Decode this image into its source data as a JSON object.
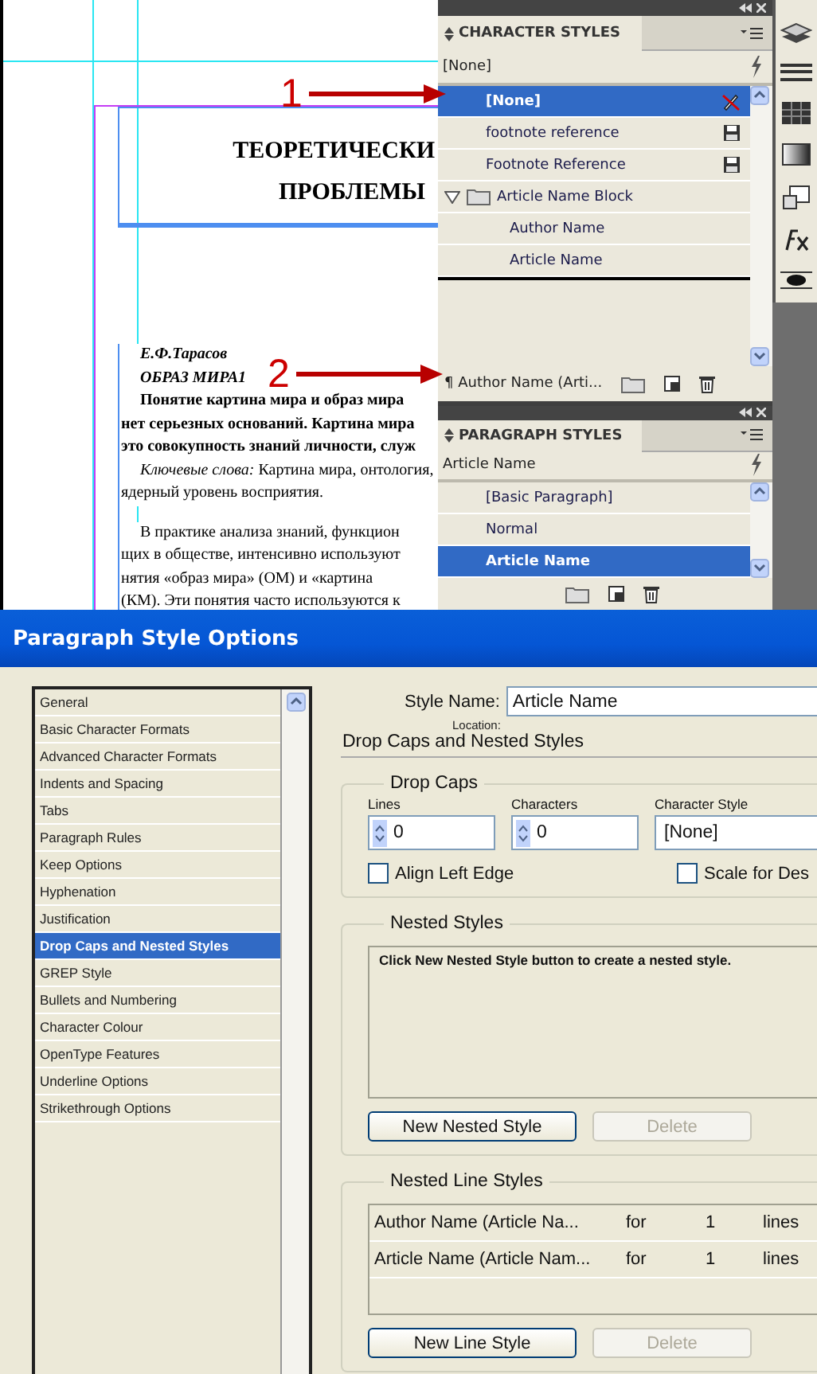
{
  "document": {
    "title_lines": [
      "ТЕОРЕТИЧЕСКИ",
      "ПРОБЛЕМЫ"
    ],
    "lines": [
      {
        "kind": "author",
        "text": "Е.Ф.Тарасов"
      },
      {
        "kind": "heading",
        "text": "ОБРАЗ МИРА1"
      },
      {
        "kind": "abstract-first",
        "text": "Понятие картина мира и образ мира"
      },
      {
        "kind": "abstract",
        "text": "нет серьезных оснований. Картина мира"
      },
      {
        "kind": "abstract",
        "text": "это совокупность знаний личности, служ"
      },
      {
        "kind": "keywords-first",
        "text": "*Ключевые слова:* Картина мира, онтология,"
      },
      {
        "kind": "keywords",
        "text": "ядерный уровень восприятия."
      },
      {
        "kind": "body-first",
        "text": "В практике анализа знаний, функцион"
      },
      {
        "kind": "body",
        "text": "щих в обществе, интенсивно используют"
      },
      {
        "kind": "body",
        "text": "нятия «образ мира» (ОМ) и «картина"
      },
      {
        "kind": "body",
        "text": "(КМ). Эти понятия часто используются к"
      }
    ]
  },
  "annotations": [
    {
      "label": "1"
    },
    {
      "label": "2"
    }
  ],
  "character_styles": {
    "title": "CHARACTER STYLES",
    "current": "[None]",
    "items": [
      {
        "label": "[None]",
        "kind": "locked",
        "selected": true
      },
      {
        "label": "footnote reference",
        "kind": "imported",
        "selected": false
      },
      {
        "label": "Footnote Reference",
        "kind": "imported",
        "selected": false
      },
      {
        "label": "Article Name Block",
        "kind": "group",
        "selected": false,
        "expanded": true,
        "children": [
          {
            "label": "Author Name",
            "selected": false
          },
          {
            "label": "Article Name",
            "selected": false
          }
        ]
      }
    ],
    "footer": "¶ Author Name (Arti..."
  },
  "paragraph_styles": {
    "title": "PARAGRAPH STYLES",
    "current": "Article Name",
    "items": [
      {
        "label": "[Basic Paragraph]",
        "selected": false
      },
      {
        "label": "Normal",
        "selected": false
      },
      {
        "label": "Article Name",
        "selected": true
      }
    ]
  },
  "dialog": {
    "title": "Paragraph Style Options",
    "categories": [
      {
        "label": "General",
        "selected": false
      },
      {
        "label": "Basic Character Formats",
        "selected": false
      },
      {
        "label": "Advanced Character Formats",
        "selected": false
      },
      {
        "label": "Indents and Spacing",
        "selected": false
      },
      {
        "label": "Tabs",
        "selected": false
      },
      {
        "label": "Paragraph Rules",
        "selected": false
      },
      {
        "label": "Keep Options",
        "selected": false
      },
      {
        "label": "Hyphenation",
        "selected": false
      },
      {
        "label": "Justification",
        "selected": false
      },
      {
        "label": "Drop Caps and Nested Styles",
        "selected": true
      },
      {
        "label": "GREP Style",
        "selected": false
      },
      {
        "label": "Bullets and Numbering",
        "selected": false
      },
      {
        "label": "Character Colour",
        "selected": false
      },
      {
        "label": "OpenType Features",
        "selected": false
      },
      {
        "label": "Underline Options",
        "selected": false
      },
      {
        "label": "Strikethrough Options",
        "selected": false
      }
    ],
    "style_name_label": "Style Name:",
    "style_name": "Article Name",
    "location_label": "Location:",
    "section_title": "Drop Caps and Nested Styles",
    "drop_caps": {
      "title": "Drop Caps",
      "lines_label": "Lines",
      "lines": "0",
      "characters_label": "Characters",
      "characters": "0",
      "character_style_label": "Character Style",
      "character_style": "[None]",
      "checkboxes": [
        {
          "label": "Align Left Edge",
          "checked": false
        },
        {
          "label": "Scale for Des",
          "checked": false
        }
      ]
    },
    "nested_styles": {
      "title": "Nested Styles",
      "message": "Click New Nested Style button to create a nested style.",
      "buttons": [
        {
          "label": "New Nested Style",
          "disabled": false
        },
        {
          "label": "Delete",
          "disabled": true
        }
      ]
    },
    "nested_line_styles": {
      "title": "Nested Line Styles",
      "rows": [
        {
          "style": "Author Name (Article Na...",
          "for": "for",
          "count": "1",
          "unit": "lines"
        },
        {
          "style": "Article Name (Article Nam...",
          "for": "for",
          "count": "1",
          "unit": "lines"
        }
      ],
      "buttons": [
        {
          "label": "New Line Style",
          "disabled": false
        },
        {
          "label": "Delete",
          "disabled": true
        }
      ]
    }
  }
}
